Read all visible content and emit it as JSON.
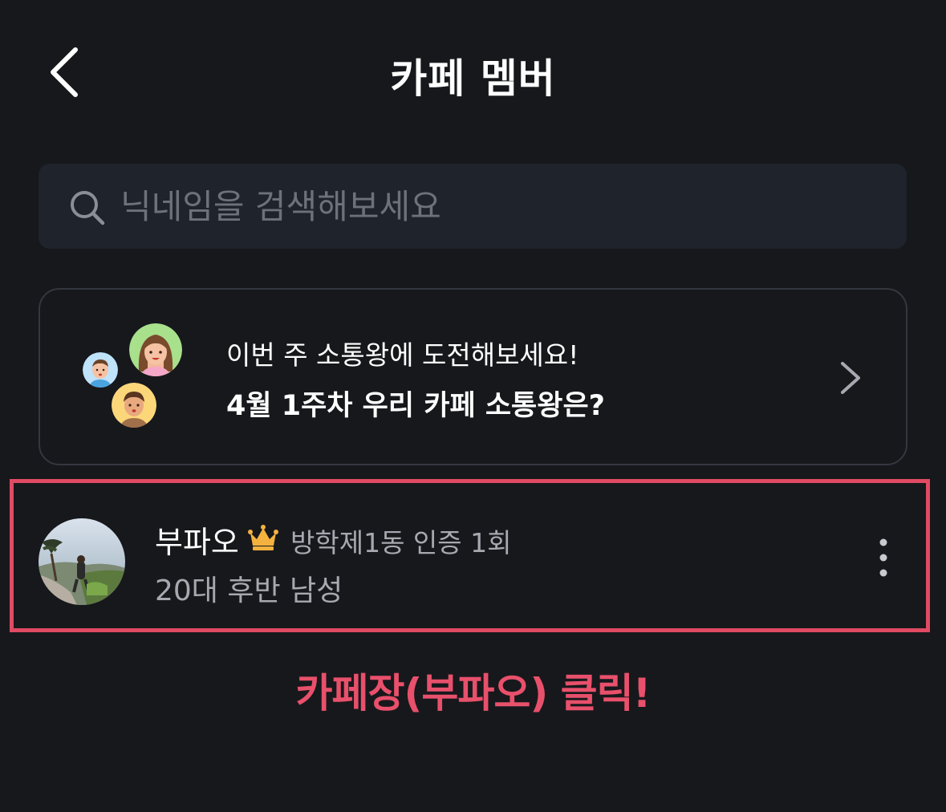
{
  "header": {
    "title": "카페 멤버",
    "back_icon": "chevron-left-icon"
  },
  "search": {
    "placeholder": "닉네임을 검색해보세요",
    "icon": "search-icon"
  },
  "banner": {
    "line1": "이번 주 소통왕에 도전해보세요!",
    "line2": "4월 1주차 우리 카페 소통왕은?",
    "icon": "chevron-right-icon"
  },
  "member": {
    "name": "부파오",
    "badge_icon": "crown-icon",
    "meta": "방학제1동 인증 1회",
    "sub": "20대 후반 남성",
    "menu_icon": "more-vertical-icon"
  },
  "annotation": {
    "text": "카페장(부파오) 클릭!"
  },
  "colors": {
    "background": "#17181c",
    "search_bg": "#1f232b",
    "highlight": "#e04a63",
    "crown": "#f3b23f"
  }
}
